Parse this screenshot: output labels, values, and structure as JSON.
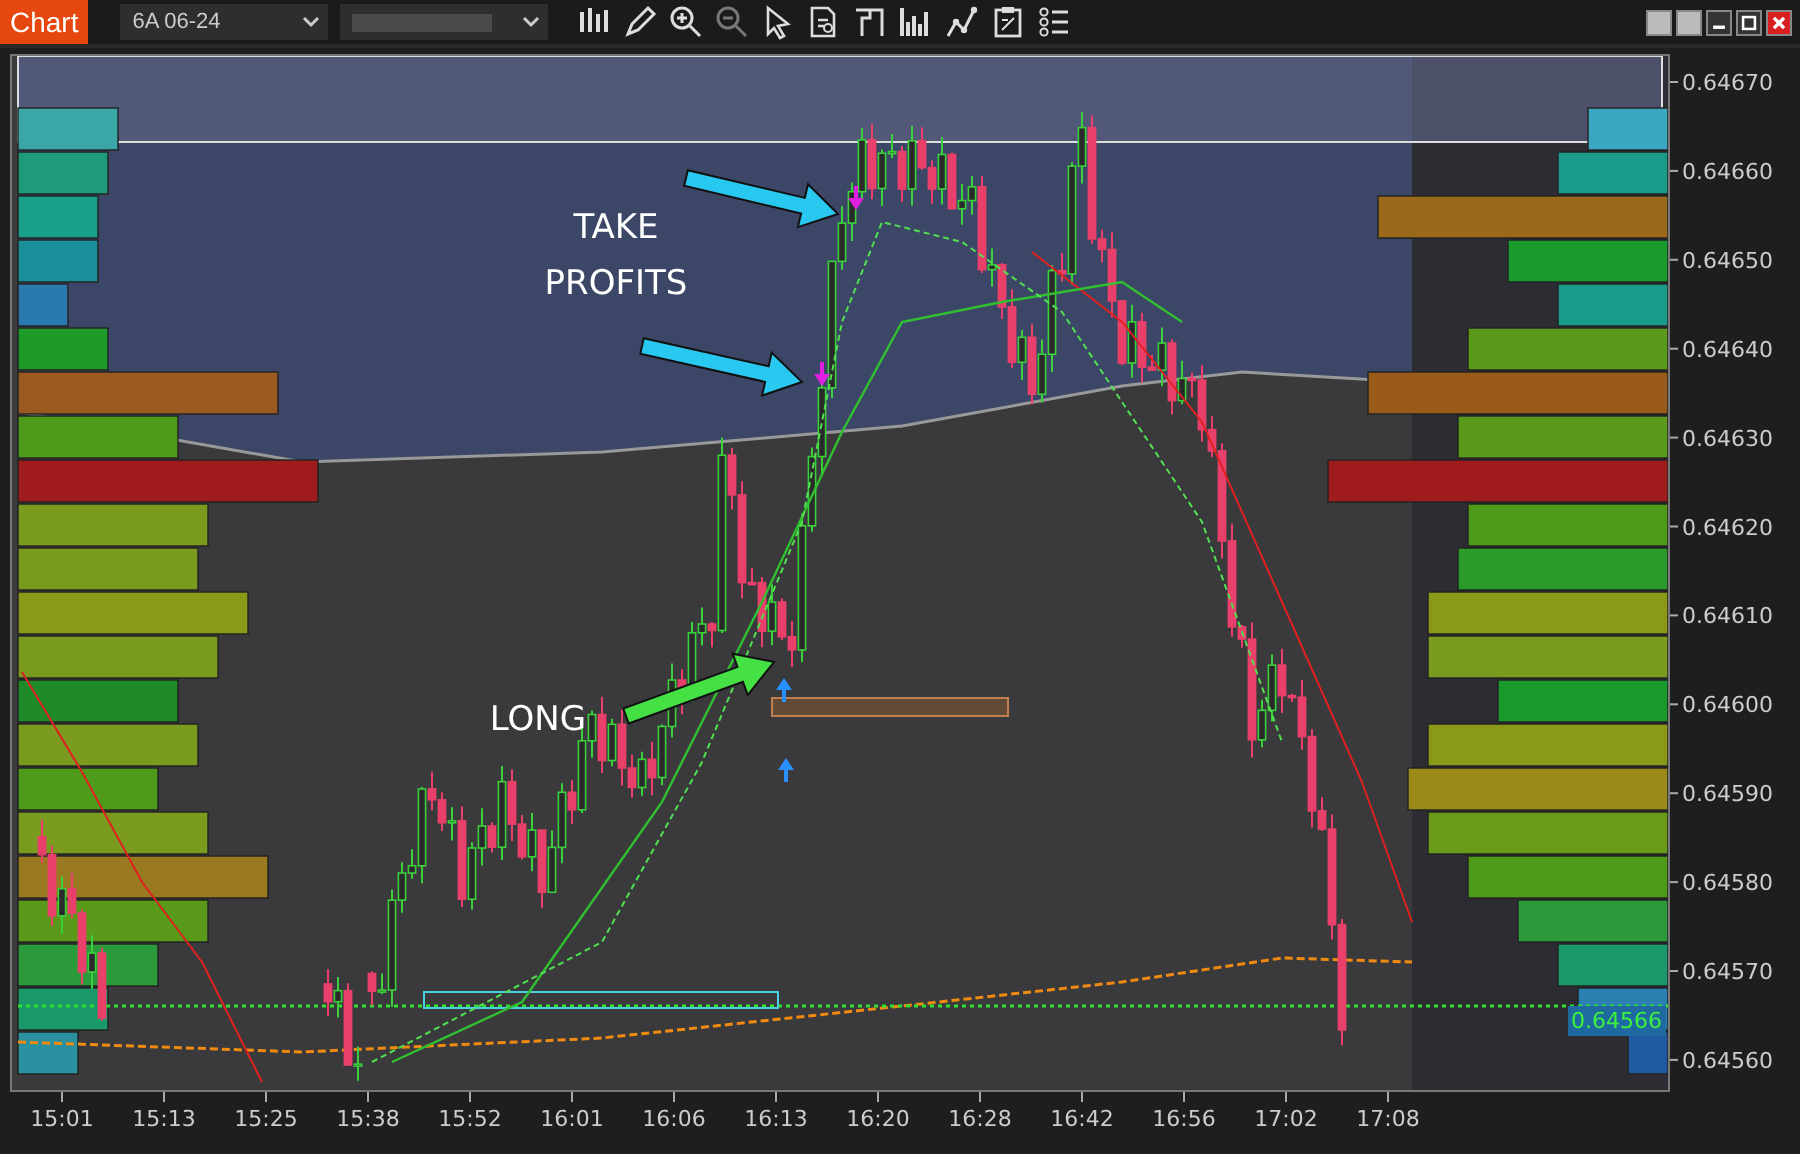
{
  "toolbar": {
    "tab": "Chart",
    "instrument": "6A 06-24"
  },
  "annotations": [
    "TAKE PROFITS",
    "LONG"
  ],
  "price_axis": {
    "labels": [
      "0.64670",
      "0.64660",
      "0.64650",
      "0.64640",
      "0.64630",
      "0.64620",
      "0.64610",
      "0.64600",
      "0.64590",
      "0.64580",
      "0.64570",
      "0.64560"
    ],
    "last_price": "0.64566"
  },
  "time_axis": {
    "labels": [
      "15:01",
      "15:13",
      "15:25",
      "15:38",
      "15:52",
      "16:01",
      "16:06",
      "16:13",
      "16:20",
      "16:28",
      "16:42",
      "16:56",
      "17:02",
      "17:08"
    ]
  }
}
